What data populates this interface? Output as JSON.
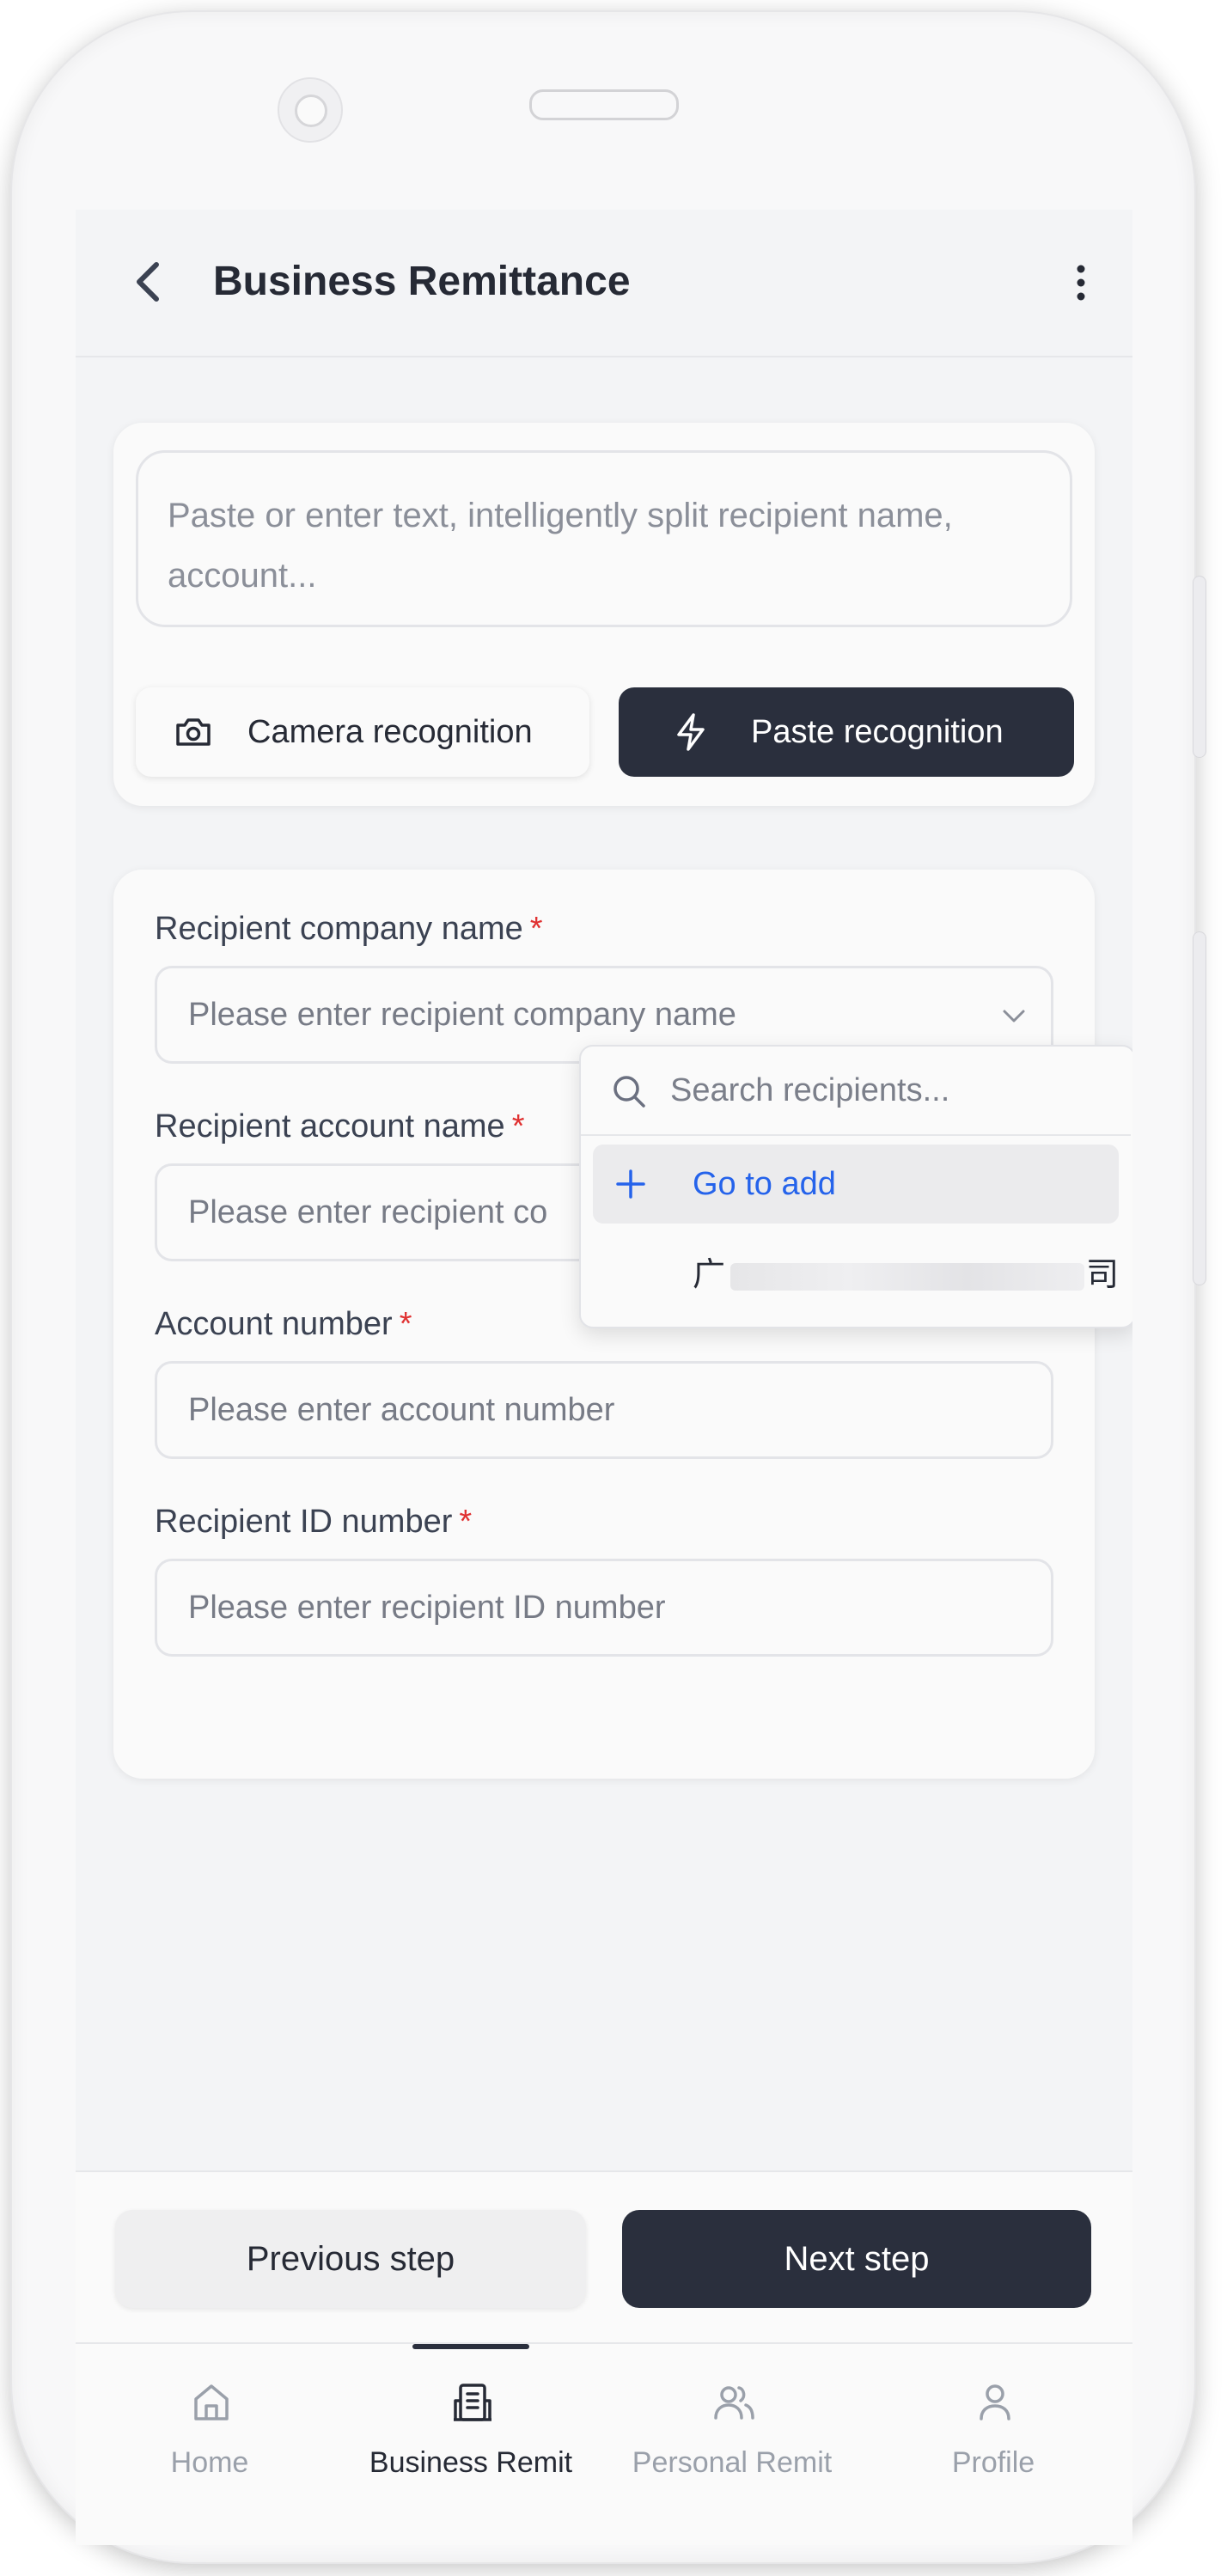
{
  "header": {
    "title": "Business Remittance"
  },
  "recognition": {
    "paste_placeholder": "Paste or enter text, intelligently split recipient name, account...",
    "camera_label": "Camera recognition",
    "paste_label": "Paste recognition"
  },
  "form": {
    "fields": [
      {
        "label": "Recipient company name",
        "required_mark": "*",
        "placeholder": "Please enter recipient company name"
      },
      {
        "label": "Recipient account name",
        "required_mark": "*",
        "placeholder": "Please enter recipient co"
      },
      {
        "label": "Account number",
        "required_mark": "*",
        "placeholder": "Please enter account number"
      },
      {
        "label": "Recipient ID number",
        "required_mark": "*",
        "placeholder": "Please enter recipient ID number"
      }
    ]
  },
  "dropdown": {
    "search_placeholder": "Search recipients...",
    "add_label": "Go to add",
    "item_first_char": "广",
    "item_last_char": "司"
  },
  "actions": {
    "prev_label": "Previous step",
    "next_label": "Next step"
  },
  "tabs": [
    {
      "label": "Home",
      "icon": "home-icon",
      "active": false
    },
    {
      "label": "Business Remit",
      "icon": "building-icon",
      "active": true
    },
    {
      "label": "Personal Remit",
      "icon": "users-icon",
      "active": false
    },
    {
      "label": "Profile",
      "icon": "user-icon",
      "active": false
    }
  ],
  "colors": {
    "primary_dark": "#2a2f3d",
    "accent_blue": "#2563eb",
    "required_red": "#e03131",
    "inactive_tab": "#9aa0aa"
  }
}
